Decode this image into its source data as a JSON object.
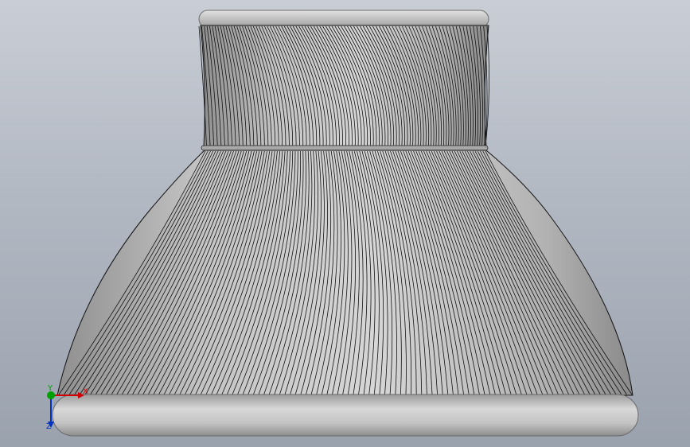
{
  "viewport": {
    "background_top": "#c9ced6",
    "background_bottom": "#9aa2ae",
    "model_color": "#bfbfbf",
    "edge_color": "#1a1a1a"
  },
  "triad": {
    "x_label": "X",
    "y_label": "Y",
    "z_label": "Z",
    "x_color": "#d40000",
    "y_color": "#00a000",
    "z_color": "#0030c0"
  }
}
